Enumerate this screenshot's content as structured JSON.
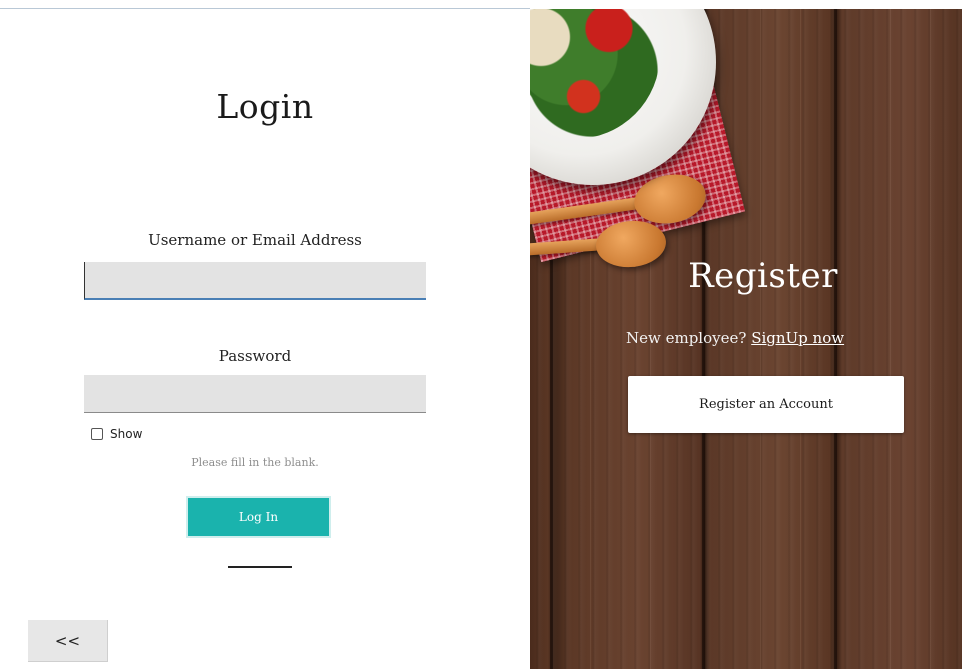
{
  "login": {
    "title": "Login",
    "username_label": "Username or Email Address",
    "username_value": "",
    "password_label": "Password",
    "password_value": "",
    "show_label": "Show",
    "show_checked": false,
    "hint": "Please fill in the blank.",
    "login_button": "Log In",
    "back_button": "<<"
  },
  "register": {
    "title": "Register",
    "prompt": "New employee?",
    "signup_link": "SignUp now",
    "register_button": "Register an Account"
  },
  "colors": {
    "accent": "#1ab3ad",
    "input_bg": "#e3e3e3",
    "wood": "#5a3624"
  }
}
